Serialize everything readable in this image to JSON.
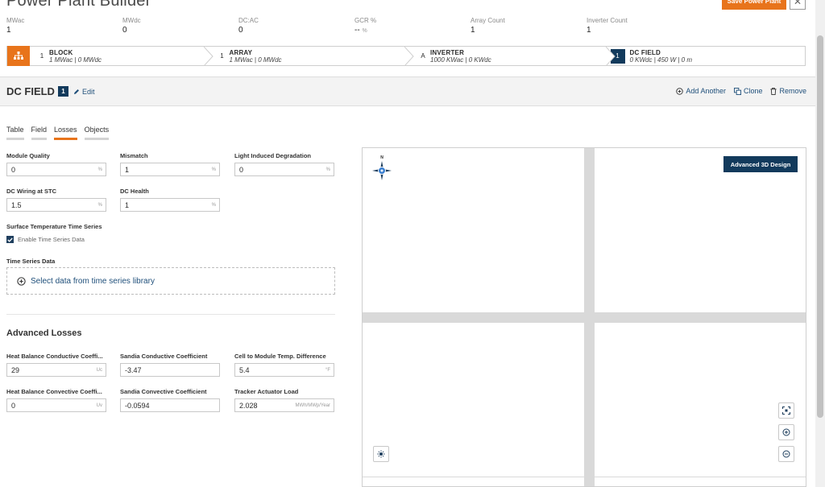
{
  "app": {
    "title": "Power Plant Builder",
    "save_label": "Save Power Plant",
    "close_icon": "close-icon"
  },
  "stats": [
    {
      "label": "MWac",
      "value": "1",
      "unit": ""
    },
    {
      "label": "MWdc",
      "value": "0",
      "unit": ""
    },
    {
      "label": "DC:AC",
      "value": "0",
      "unit": ""
    },
    {
      "label": "GCR %",
      "value": "--",
      "unit": "%"
    },
    {
      "label": "Array Count",
      "value": "1",
      "unit": ""
    },
    {
      "label": "Inverter Count",
      "value": "1",
      "unit": ""
    }
  ],
  "breadcrumb": [
    {
      "num": "1",
      "title": "BLOCK",
      "sub": "1 MWac | 0 MWdc",
      "icon": "hierarchy-icon"
    },
    {
      "num": "1",
      "title": "ARRAY",
      "sub": "1 MWac | 0 MWdc"
    },
    {
      "num": "A",
      "title": "INVERTER",
      "sub": "1000 KWac | 0 KWdc"
    },
    {
      "num": "1",
      "title": "DC FIELD",
      "sub": "0 KWdc | 450 W | 0 m"
    }
  ],
  "section": {
    "title": "DC FIELD",
    "badge": "1",
    "edit_label": "Edit",
    "actions": {
      "add_another": "Add Another",
      "clone": "Clone",
      "remove": "Remove"
    }
  },
  "tabs": [
    "Table",
    "Field",
    "Losses",
    "Objects"
  ],
  "active_tab": "Losses",
  "losses": {
    "module_quality": {
      "label": "Module Quality",
      "value": "0",
      "unit": "%"
    },
    "mismatch": {
      "label": "Mismatch",
      "value": "1",
      "unit": "%"
    },
    "lid": {
      "label": "Light Induced Degradation",
      "value": "0",
      "unit": "%"
    },
    "dc_wiring": {
      "label": "DC Wiring at STC",
      "value": "1.5",
      "unit": "%"
    },
    "dc_health": {
      "label": "DC Health",
      "value": "1",
      "unit": "%"
    }
  },
  "surface_temp": {
    "label": "Surface Temperature Time Series",
    "checkbox_label": "Enable Time Series Data",
    "checked": true
  },
  "time_series": {
    "label": "Time Series Data",
    "select_label": "Select data from time series library"
  },
  "advanced": {
    "title": "Advanced Losses",
    "hb_conductive": {
      "label": "Heat Balance Conductive Coeffi...",
      "value": "29",
      "unit": "Uc"
    },
    "sandia_conductive": {
      "label": "Sandia Conductive Coefficient",
      "value": "-3.47",
      "unit": ""
    },
    "cell_module": {
      "label": "Cell to Module Temp. Difference",
      "value": "5.4",
      "unit": "°F"
    },
    "hb_convective": {
      "label": "Heat Balance Convective Coeffi...",
      "value": "0",
      "unit": "Uv"
    },
    "sandia_convective": {
      "label": "Sandia Convective Coefficient",
      "value": "-0.0594",
      "unit": ""
    },
    "tracker_load": {
      "label": "Tracker Actuator Load",
      "value": "2.028",
      "unit": "MWh/MWp/Year"
    }
  },
  "map": {
    "compass_label": "N",
    "advanced_3d_label": "Advanced 3D Design"
  },
  "colors": {
    "accent": "#e8741b",
    "navy": "#123a5c",
    "link": "#1f4f7a"
  }
}
